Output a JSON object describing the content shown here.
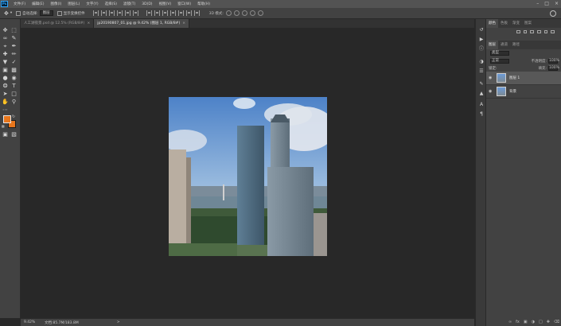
{
  "menubar": {
    "logo": "Ps",
    "items": [
      "文件(F)",
      "编辑(E)",
      "图像(I)",
      "图层(L)",
      "文字(Y)",
      "选择(S)",
      "滤镜(T)",
      "3D(D)",
      "视图(V)",
      "窗口(W)",
      "帮助(H)"
    ]
  },
  "options": {
    "auto_select_label": "自动选择:",
    "auto_select_value": "图层",
    "show_transform_label": "显示变换控件",
    "mode_3d_label": "3D 模式:"
  },
  "tabs": [
    {
      "label": "人工湖夜景.psd @ 12.5% (RGB/8#)",
      "active": false
    },
    {
      "label": "jp20190807_01.jpg @ 9.42% (图层 1, RGB/8#)",
      "active": true
    }
  ],
  "status": {
    "zoom": "9.42%",
    "doc_size": "文档:85.7M/183.8M",
    "arrow": ">"
  },
  "panels": {
    "top_tabs": [
      "颜色",
      "色板",
      "渐变",
      "图案"
    ],
    "layer_tabs": [
      "图层",
      "通道",
      "路径"
    ],
    "kind_label": "类型",
    "blend_mode": "正常",
    "opacity_label": "不透明度:",
    "opacity_value": "100%",
    "lock_label": "锁定:",
    "fill_label": "填充:",
    "fill_value": "100%",
    "layers": [
      {
        "name": "图层 1",
        "selected": true
      },
      {
        "name": "背景",
        "selected": false
      }
    ]
  },
  "colors": {
    "foreground": "#e8761c",
    "background": "#e8761c",
    "accent": "#31a8ff"
  }
}
